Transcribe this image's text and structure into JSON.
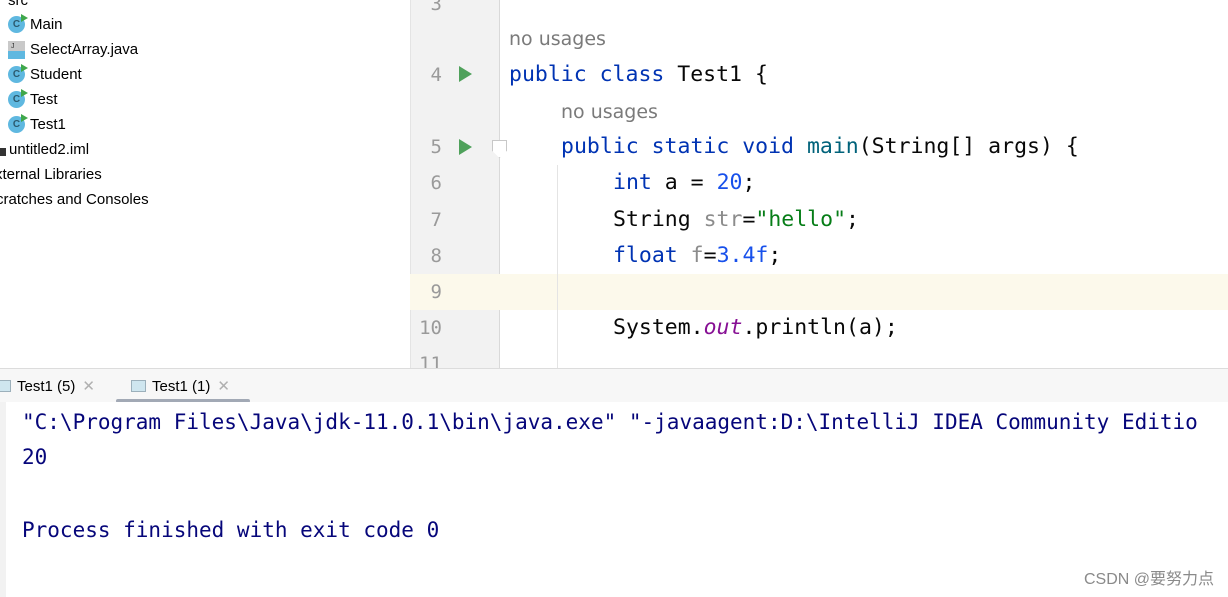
{
  "project_tree": {
    "items": [
      {
        "label": "src",
        "icon": "folder-icon"
      },
      {
        "label": "Main",
        "icon": "java-class-icon"
      },
      {
        "label": "SelectArray.java",
        "icon": "java-file-icon"
      },
      {
        "label": "Student",
        "icon": "java-class-icon"
      },
      {
        "label": "Test",
        "icon": "java-class-icon"
      },
      {
        "label": "Test1",
        "icon": "java-class-icon"
      },
      {
        "label": "untitled2.iml",
        "icon": "iml-file-icon"
      },
      {
        "label": "xternal Libraries",
        "icon": "library-icon"
      },
      {
        "label": "cratches and Consoles",
        "icon": "scratches-icon"
      }
    ]
  },
  "editor": {
    "line_numbers": [
      "3",
      "4",
      "5",
      "6",
      "7",
      "8",
      "9",
      "10",
      "11"
    ],
    "hints": [
      "no usages",
      "no usages"
    ],
    "code": {
      "l4": [
        [
          "kw",
          "public "
        ],
        [
          "kw",
          "class "
        ],
        [
          "plain",
          "Test1 {"
        ]
      ],
      "l5": [
        [
          "kw",
          "public "
        ],
        [
          "kw",
          "static "
        ],
        [
          "kw",
          "void "
        ],
        [
          "decl",
          "main"
        ],
        [
          "plain",
          "(String[] args) {"
        ]
      ],
      "l6": [
        [
          "kw",
          "int "
        ],
        [
          "plain",
          "a = "
        ],
        [
          "num",
          "20"
        ],
        [
          "plain",
          ";"
        ]
      ],
      "l7": [
        [
          "plain",
          "String "
        ],
        [
          "unused",
          "str"
        ],
        [
          "plain",
          "="
        ],
        [
          "str",
          "\"hello\""
        ],
        [
          "plain",
          ";"
        ]
      ],
      "l8": [
        [
          "kw",
          "float "
        ],
        [
          "unused",
          "f"
        ],
        [
          "plain",
          "="
        ],
        [
          "num",
          "3.4f"
        ],
        [
          "plain",
          ";"
        ]
      ],
      "l10": [
        [
          "plain",
          "System."
        ],
        [
          "sfield",
          "out"
        ],
        [
          "plain",
          ".println(a);"
        ]
      ]
    }
  },
  "run_tabs": [
    {
      "label": "Test1 (5)",
      "active": false
    },
    {
      "label": "Test1 (1)",
      "active": true
    }
  ],
  "console": {
    "lines": [
      "\"C:\\Program Files\\Java\\jdk-11.0.1\\bin\\java.exe\" \"-javaagent:D:\\IntelliJ IDEA Community Editio",
      "20",
      "",
      "Process finished with exit code 0"
    ]
  },
  "watermark": "CSDN @要努力点"
}
